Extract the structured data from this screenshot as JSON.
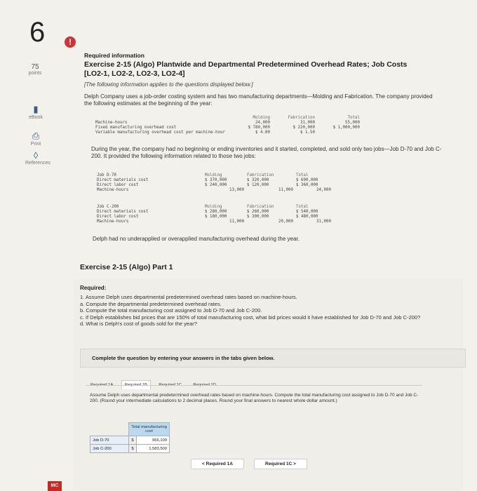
{
  "question_number": "6",
  "rail": {
    "points_value": "75",
    "points_label": "points",
    "tools": [
      {
        "label": "eBook",
        "icon": "book-icon"
      },
      {
        "label": "Print",
        "icon": "print-icon"
      },
      {
        "label": "References",
        "icon": "references-icon"
      }
    ]
  },
  "info": {
    "heading": "Required information",
    "title": "Exercise 2-15 (Algo) Plantwide and Departmental Predetermined Overhead Rates; Job Costs [LO2-1, LO2-2, LO2-3, LO2-4]",
    "note": "[The following information applies to the questions displayed below.]",
    "intro": "Delph Company uses a job-order costing system and has two manufacturing departments—Molding and Fabrication. The company provided the following estimates at the beginning of the year:",
    "est_table": {
      "headers": [
        "Molding",
        "Fabrication",
        "Total"
      ],
      "rows": [
        {
          "label": "Machine-hours",
          "values": [
            "24,000",
            "31,000",
            "55,000"
          ]
        },
        {
          "label": "Fixed manufacturing overhead cost",
          "values": [
            "$ 780,000",
            "$ 220,000",
            "$ 1,000,000"
          ]
        },
        {
          "label": "Variable manufacturing overhead cost per machine-hour",
          "values": [
            "$ 4.00",
            "$ 1.50",
            ""
          ]
        }
      ]
    },
    "during": "During the year, the company had no beginning or ending inventories and it started, completed, and sold only two jobs—Job D-70 and Job C-200. It provided the following information related to those two jobs:",
    "job_d70": {
      "headers": [
        "Molding",
        "Fabrication",
        "Total"
      ],
      "title": "Job D-70",
      "rows": [
        {
          "label": "Direct materials cost",
          "values": [
            "$ 370,000",
            "$ 320,000",
            "$ 690,000"
          ]
        },
        {
          "label": "Direct labor cost",
          "values": [
            "$ 240,000",
            "$ 120,000",
            "$ 360,000"
          ]
        },
        {
          "label": "Machine-hours",
          "values": [
            "13,000",
            "11,000",
            "24,000"
          ]
        }
      ]
    },
    "job_c200": {
      "headers": [
        "Molding",
        "Fabrication",
        "Total"
      ],
      "title": "Job C-200",
      "rows": [
        {
          "label": "Direct materials cost",
          "values": [
            "$ 280,000",
            "$ 260,000",
            "$ 540,000"
          ]
        },
        {
          "label": "Direct labor cost",
          "values": [
            "$ 180,000",
            "$ 300,000",
            "$ 480,000"
          ]
        },
        {
          "label": "Machine-hours",
          "values": [
            "11,000",
            "20,000",
            "31,000"
          ]
        }
      ]
    },
    "closing": "Delph had no underapplied or overapplied manufacturing overhead during the year."
  },
  "part": {
    "title": "Exercise 2-15 (Algo) Part 1",
    "required_label": "Required:",
    "items": [
      "1. Assume Delph uses departmental predetermined overhead rates based on machine-hours.",
      "a. Compute the departmental predetermined overhead rates.",
      "b. Compute the total manufacturing cost assigned to Job D-70 and Job C-200.",
      "c. If Delph establishes bid prices that are 150% of total manufacturing cost, what bid prices would it have established for Job D-70 and Job C-200?",
      "d. What is Delph's cost of goods sold for the year?"
    ],
    "complete_text": "Complete the question by entering your answers in the tabs given below."
  },
  "tabs": [
    "Required 1A",
    "Required 1B",
    "Required 1C",
    "Required 1D"
  ],
  "active_tab": "Required 1B",
  "instructions": "Assume Delph uses departmental predetermined overhead rates based on machine-hours. Compute the total manufacturing cost assigned to Job D-70 and Job C-200. (Round your intermediate calculations to 2 decimal places. Round your final answers to nearest whole dollar amount.)",
  "answer_table": {
    "header": "Total manufacturing cost",
    "rows": [
      {
        "label": "Job D-70",
        "currency": "$",
        "value": "966,100"
      },
      {
        "label": "Job C-200",
        "currency": "$",
        "value": "1,583,500"
      }
    ]
  },
  "nav": {
    "prev": "< Required 1A",
    "next": "Required 1C >"
  },
  "logo": "MC"
}
